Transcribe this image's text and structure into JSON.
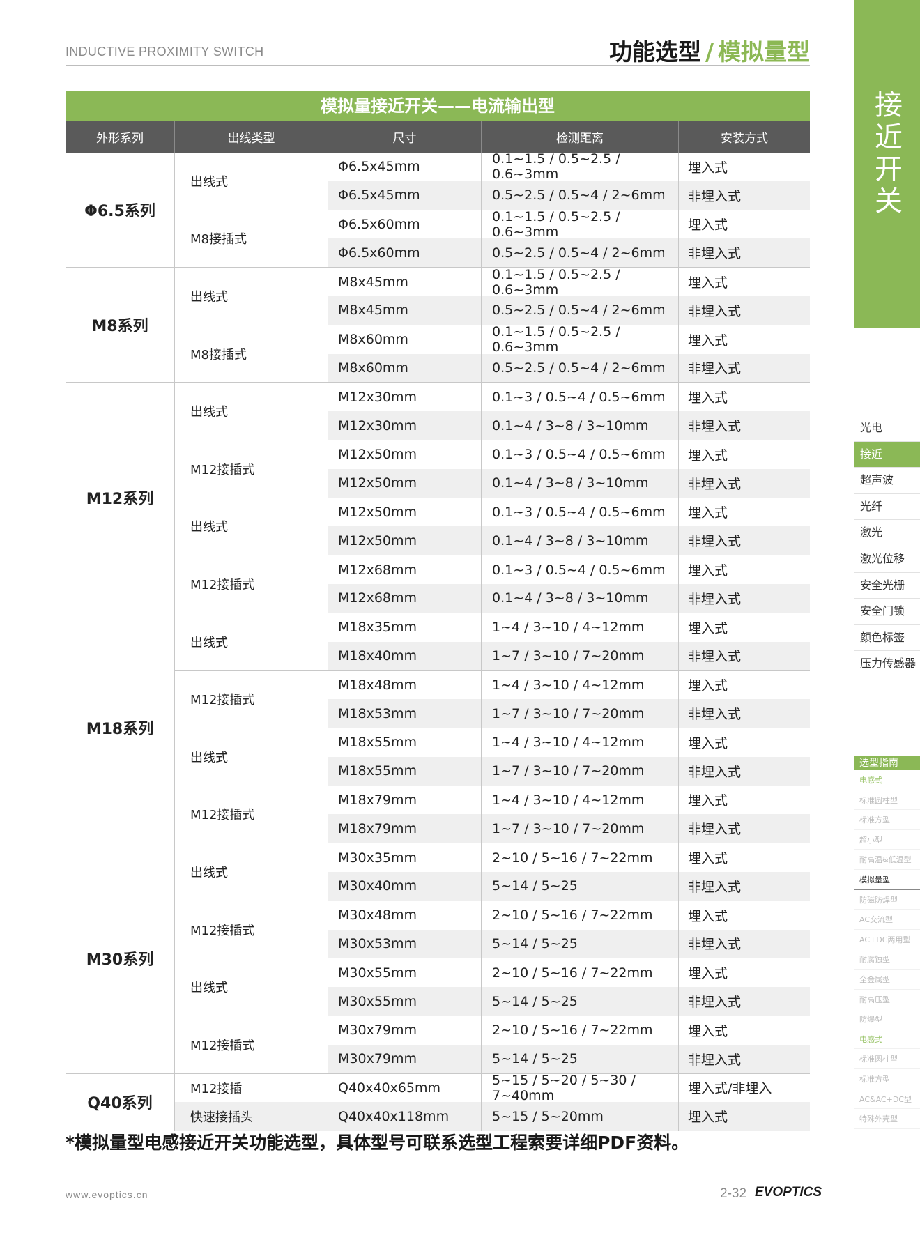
{
  "header": {
    "left": "INDUCTIVE PROXIMITY SWITCH",
    "right_main": "功能选型",
    "right_sep": "/",
    "right_sub": "模拟量型"
  },
  "table": {
    "title": "模拟量接近开关——电流输出型",
    "columns": [
      "外形系列",
      "出线类型",
      "尺寸",
      "检测距离",
      "安装方式"
    ],
    "groups": [
      {
        "name": "Φ6.5系列",
        "subs": [
          {
            "type": "出线式",
            "rows": [
              {
                "size": "Φ6.5x45mm",
                "dist": "0.1~1.5 / 0.5~2.5 / 0.6~3mm",
                "mount": "埋入式"
              },
              {
                "size": "Φ6.5x45mm",
                "dist": "0.5~2.5 / 0.5~4 / 2~6mm",
                "mount": "非埋入式"
              }
            ]
          },
          {
            "type": "M8接插式",
            "rows": [
              {
                "size": "Φ6.5x60mm",
                "dist": "0.1~1.5 / 0.5~2.5 / 0.6~3mm",
                "mount": "埋入式"
              },
              {
                "size": "Φ6.5x60mm",
                "dist": "0.5~2.5 / 0.5~4 / 2~6mm",
                "mount": "非埋入式"
              }
            ]
          }
        ]
      },
      {
        "name": "M8系列",
        "subs": [
          {
            "type": "出线式",
            "rows": [
              {
                "size": "M8x45mm",
                "dist": "0.1~1.5 / 0.5~2.5 / 0.6~3mm",
                "mount": "埋入式"
              },
              {
                "size": "M8x45mm",
                "dist": "0.5~2.5 / 0.5~4 / 2~6mm",
                "mount": "非埋入式"
              }
            ]
          },
          {
            "type": "M8接插式",
            "rows": [
              {
                "size": "M8x60mm",
                "dist": "0.1~1.5 / 0.5~2.5 / 0.6~3mm",
                "mount": "埋入式"
              },
              {
                "size": "M8x60mm",
                "dist": "0.5~2.5 / 0.5~4 / 2~6mm",
                "mount": "非埋入式"
              }
            ]
          }
        ]
      },
      {
        "name": "M12系列",
        "subs": [
          {
            "type": "出线式",
            "rows": [
              {
                "size": "M12x30mm",
                "dist": "0.1~3 / 0.5~4 / 0.5~6mm",
                "mount": "埋入式"
              },
              {
                "size": "M12x30mm",
                "dist": "0.1~4 / 3~8 / 3~10mm",
                "mount": "非埋入式"
              }
            ]
          },
          {
            "type": "M12接插式",
            "rows": [
              {
                "size": "M12x50mm",
                "dist": "0.1~3 / 0.5~4 / 0.5~6mm",
                "mount": "埋入式"
              },
              {
                "size": "M12x50mm",
                "dist": "0.1~4 / 3~8 / 3~10mm",
                "mount": "非埋入式"
              }
            ]
          },
          {
            "type": "出线式",
            "rows": [
              {
                "size": "M12x50mm",
                "dist": "0.1~3 / 0.5~4 / 0.5~6mm",
                "mount": "埋入式"
              },
              {
                "size": "M12x50mm",
                "dist": "0.1~4 / 3~8 / 3~10mm",
                "mount": "非埋入式"
              }
            ]
          },
          {
            "type": "M12接插式",
            "rows": [
              {
                "size": "M12x68mm",
                "dist": "0.1~3 / 0.5~4 / 0.5~6mm",
                "mount": "埋入式"
              },
              {
                "size": "M12x68mm",
                "dist": "0.1~4 / 3~8 / 3~10mm",
                "mount": "非埋入式"
              }
            ]
          }
        ]
      },
      {
        "name": "M18系列",
        "subs": [
          {
            "type": "出线式",
            "rows": [
              {
                "size": "M18x35mm",
                "dist": "1~4 / 3~10 / 4~12mm",
                "mount": "埋入式"
              },
              {
                "size": "M18x40mm",
                "dist": "1~7 / 3~10 / 7~20mm",
                "mount": "非埋入式"
              }
            ]
          },
          {
            "type": "M12接插式",
            "rows": [
              {
                "size": "M18x48mm",
                "dist": "1~4 / 3~10 / 4~12mm",
                "mount": "埋入式"
              },
              {
                "size": "M18x53mm",
                "dist": "1~7 / 3~10 / 7~20mm",
                "mount": "非埋入式"
              }
            ]
          },
          {
            "type": "出线式",
            "rows": [
              {
                "size": "M18x55mm",
                "dist": "1~4 / 3~10 / 4~12mm",
                "mount": "埋入式"
              },
              {
                "size": "M18x55mm",
                "dist": "1~7 / 3~10 / 7~20mm",
                "mount": "非埋入式"
              }
            ]
          },
          {
            "type": "M12接插式",
            "rows": [
              {
                "size": "M18x79mm",
                "dist": "1~4 / 3~10 / 4~12mm",
                "mount": "埋入式"
              },
              {
                "size": "M18x79mm",
                "dist": "1~7 / 3~10 / 7~20mm",
                "mount": "非埋入式"
              }
            ]
          }
        ]
      },
      {
        "name": "M30系列",
        "subs": [
          {
            "type": "出线式",
            "rows": [
              {
                "size": "M30x35mm",
                "dist": "2~10 / 5~16 / 7~22mm",
                "mount": "埋入式"
              },
              {
                "size": "M30x40mm",
                "dist": "5~14 / 5~25",
                "mount": "非埋入式"
              }
            ]
          },
          {
            "type": "M12接插式",
            "rows": [
              {
                "size": "M30x48mm",
                "dist": "2~10 / 5~16 / 7~22mm",
                "mount": "埋入式"
              },
              {
                "size": "M30x53mm",
                "dist": "5~14 / 5~25",
                "mount": "非埋入式"
              }
            ]
          },
          {
            "type": "出线式",
            "rows": [
              {
                "size": "M30x55mm",
                "dist": "2~10 / 5~16 / 7~22mm",
                "mount": "埋入式"
              },
              {
                "size": "M30x55mm",
                "dist": "5~14 / 5~25",
                "mount": "非埋入式"
              }
            ]
          },
          {
            "type": "M12接插式",
            "rows": [
              {
                "size": "M30x79mm",
                "dist": "2~10 / 5~16 / 7~22mm",
                "mount": "埋入式"
              },
              {
                "size": "M30x79mm",
                "dist": "5~14 / 5~25",
                "mount": "非埋入式"
              }
            ]
          }
        ]
      }
    ],
    "q40": {
      "name": "Q40系列",
      "rows": [
        {
          "type": "M12接插",
          "size": "Q40x40x65mm",
          "dist": "5~15 / 5~20 / 5~30 / 7~40mm",
          "mount": "埋入式/非埋入"
        },
        {
          "type": "快速接插头",
          "size": "Q40x40x118mm",
          "dist": "5~15 / 5~20mm",
          "mount": "埋入式"
        }
      ]
    }
  },
  "footnote": "*模拟量型电感接近开关功能选型，具体型号可联系选型工程索要详细PDF资料。",
  "footer": {
    "url": "www.evoptics.cn",
    "page": "2-32",
    "brand": "EVOPTICS"
  },
  "side_tab": "接近开关",
  "nav": [
    "光电",
    "接近",
    "超声波",
    "光纤",
    "激光",
    "激光位移",
    "安全光栅",
    "安全门锁",
    "颜色标签",
    "压力传感器"
  ],
  "nav_active": "接近",
  "guide": {
    "head": "选型指南",
    "items": [
      {
        "label": "电感式",
        "kind": "cat"
      },
      {
        "label": "标准圆柱型",
        "kind": ""
      },
      {
        "label": "标准方型",
        "kind": ""
      },
      {
        "label": "超小型",
        "kind": ""
      },
      {
        "label": "耐高温&低温型",
        "kind": ""
      },
      {
        "label": "模拟量型",
        "kind": "active"
      },
      {
        "label": "防磁防焊型",
        "kind": ""
      },
      {
        "label": "AC交流型",
        "kind": ""
      },
      {
        "label": "AC+DC两用型",
        "kind": ""
      },
      {
        "label": "耐腐蚀型",
        "kind": ""
      },
      {
        "label": "全金属型",
        "kind": ""
      },
      {
        "label": "耐高压型",
        "kind": ""
      },
      {
        "label": "防爆型",
        "kind": ""
      },
      {
        "label": "电感式",
        "kind": "cat"
      },
      {
        "label": "标准圆柱型",
        "kind": ""
      },
      {
        "label": "标准方型",
        "kind": ""
      },
      {
        "label": "AC&AC+DC型",
        "kind": ""
      },
      {
        "label": "特殊外壳型",
        "kind": ""
      }
    ]
  },
  "colors": {
    "accent": "#8bb856",
    "header_bg": "#5a5a5a",
    "alt_row": "#efefef"
  }
}
